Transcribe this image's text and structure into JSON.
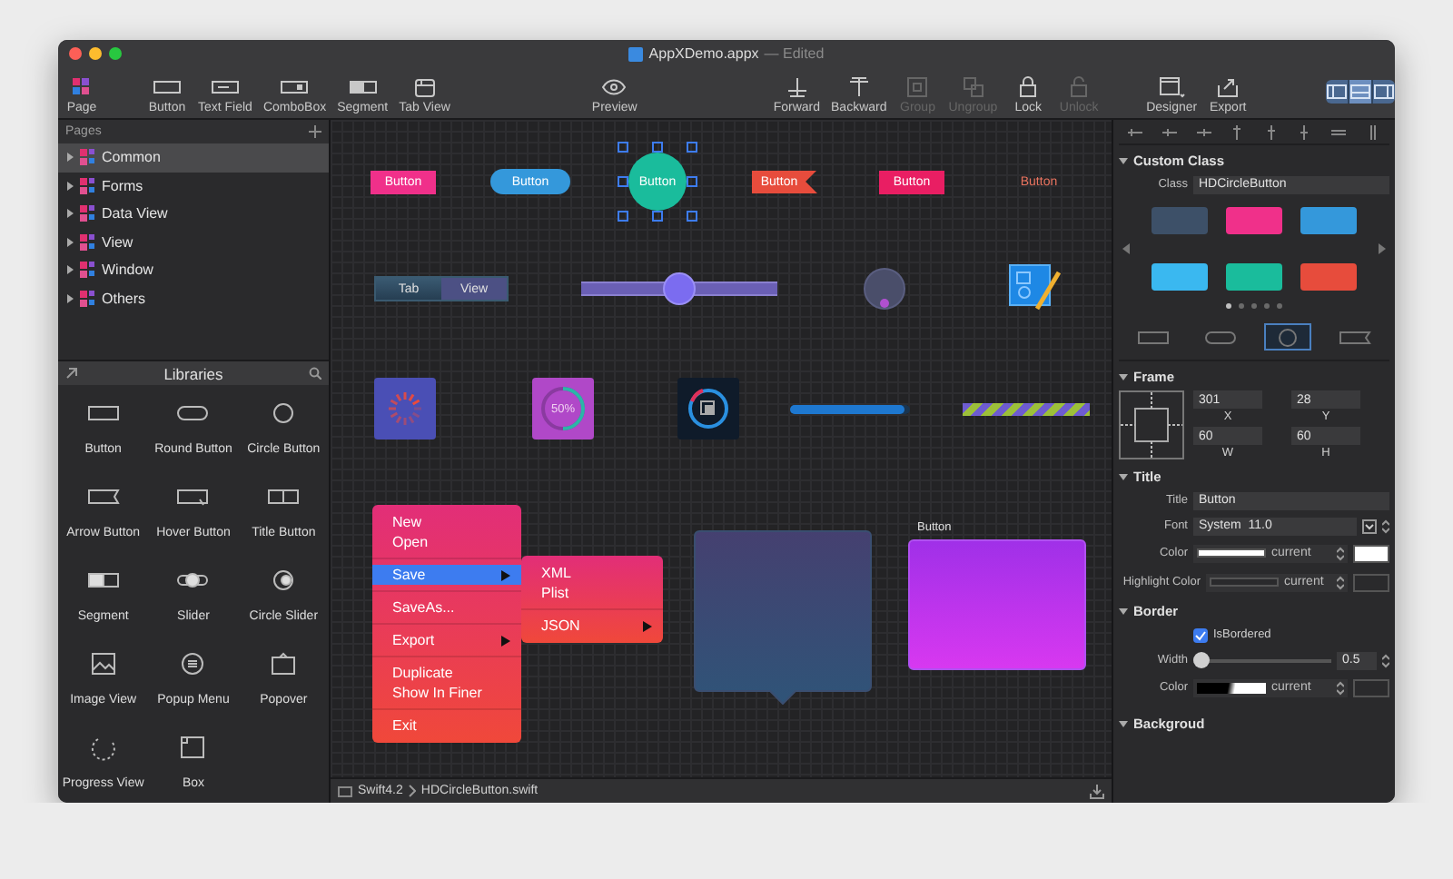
{
  "window": {
    "title": "AppXDemo.appx",
    "status": "— Edited"
  },
  "toolbar": {
    "groups": [
      {
        "items": [
          {
            "kind": "page",
            "label": "Page",
            "disabled": false
          }
        ]
      },
      {
        "items": [
          {
            "kind": "button",
            "label": "Button",
            "disabled": false
          },
          {
            "kind": "textfield",
            "label": "Text Field",
            "disabled": false
          },
          {
            "kind": "combobox",
            "label": "ComboBox",
            "disabled": false
          },
          {
            "kind": "segment",
            "label": "Segment",
            "disabled": false
          },
          {
            "kind": "tabview",
            "label": "Tab View",
            "disabled": false
          }
        ]
      },
      {
        "items": [
          {
            "kind": "preview",
            "label": "Preview",
            "disabled": false
          }
        ]
      },
      {
        "items": [
          {
            "kind": "forward",
            "label": "Forward",
            "disabled": false
          },
          {
            "kind": "backward",
            "label": "Backward",
            "disabled": false
          },
          {
            "kind": "group",
            "label": "Group",
            "disabled": true
          },
          {
            "kind": "ungroup",
            "label": "Ungroup",
            "disabled": true
          },
          {
            "kind": "lock",
            "label": "Lock",
            "disabled": false
          },
          {
            "kind": "unlock",
            "label": "Unlock",
            "disabled": true
          }
        ]
      },
      {
        "items": [
          {
            "kind": "designer",
            "label": "Designer",
            "disabled": false
          },
          {
            "kind": "export",
            "label": "Export",
            "disabled": false
          }
        ]
      }
    ],
    "view_modes": [
      {
        "kind": "left",
        "selected": false
      },
      {
        "kind": "bottom",
        "selected": true
      },
      {
        "kind": "right",
        "selected": false
      }
    ]
  },
  "pages": {
    "title": "Pages",
    "items": [
      {
        "label": "Common",
        "selected": true,
        "expanded": false
      },
      {
        "label": "Forms",
        "selected": false,
        "expanded": false
      },
      {
        "label": "Data View",
        "selected": false,
        "expanded": false
      },
      {
        "label": "View",
        "selected": false,
        "expanded": false
      },
      {
        "label": "Window",
        "selected": false,
        "expanded": false
      },
      {
        "label": "Others",
        "selected": false,
        "expanded": false
      }
    ]
  },
  "libraries": {
    "title": "Libraries",
    "items": [
      {
        "kind": "button",
        "label": "Button"
      },
      {
        "kind": "round",
        "label": "Round Button"
      },
      {
        "kind": "circle",
        "label": "Circle Button"
      },
      {
        "kind": "arrow",
        "label": "Arrow Button"
      },
      {
        "kind": "hover",
        "label": "Hover Button"
      },
      {
        "kind": "title",
        "label": "Title Button"
      },
      {
        "kind": "segment",
        "label": "Segment"
      },
      {
        "kind": "slider",
        "label": "Slider"
      },
      {
        "kind": "circleslider",
        "label": "Circle Slider"
      },
      {
        "kind": "image",
        "label": "Image View"
      },
      {
        "kind": "popup",
        "label": "Popup Menu"
      },
      {
        "kind": "popover",
        "label": "Popover"
      },
      {
        "kind": "progress",
        "label": "Progress View"
      },
      {
        "kind": "box",
        "label": "Box"
      }
    ]
  },
  "canvas": {
    "buttons": [
      {
        "kind": "rect",
        "label": "Button",
        "color": "#f0308a",
        "selected": false
      },
      {
        "kind": "pill",
        "label": "Button",
        "color": "#3498db",
        "selected": false
      },
      {
        "kind": "circle",
        "label": "Button",
        "color": "#1abc9c",
        "selected": true
      },
      {
        "kind": "ribbon",
        "label": "Button",
        "color": "#e74c3c",
        "selected": false
      },
      {
        "kind": "rect",
        "label": "Button",
        "color": "#e91e63",
        "selected": false
      },
      {
        "kind": "text",
        "label": "Button",
        "color": "#e8735f",
        "selected": false
      }
    ],
    "tab_view": {
      "tabs": [
        {
          "label": "Tab",
          "selected": true
        },
        {
          "label": "View",
          "selected": false
        }
      ]
    },
    "slider": {
      "level": 0.5
    },
    "progress_ring": {
      "label": "50%",
      "level": 0.5
    },
    "progress_bar": {
      "level": 0.96
    },
    "striped_bar": {
      "level": 1.0
    },
    "menu": {
      "sections": [
        [
          {
            "label": "New",
            "selected": false,
            "submenu": false
          },
          {
            "label": "Open",
            "selected": false,
            "submenu": false
          }
        ],
        [
          {
            "label": "Save",
            "selected": true,
            "submenu": true
          }
        ],
        [
          {
            "label": "SaveAs...",
            "selected": false,
            "submenu": false
          }
        ],
        [
          {
            "label": "Export",
            "selected": false,
            "submenu": true
          }
        ],
        [
          {
            "label": "Duplicate",
            "selected": false,
            "submenu": false
          },
          {
            "label": "Show In Finer",
            "selected": false,
            "submenu": false
          }
        ],
        [
          {
            "label": "Exit",
            "selected": false,
            "submenu": false
          }
        ]
      ]
    },
    "submenu": {
      "sections": [
        [
          {
            "label": "XML",
            "selected": false,
            "submenu": false
          },
          {
            "label": "Plist",
            "selected": false,
            "submenu": false
          }
        ],
        [
          {
            "label": "JSON",
            "selected": false,
            "submenu": true
          }
        ]
      ]
    },
    "box": {
      "title": "Button"
    }
  },
  "path_bar": {
    "items": [
      "Swift4.2",
      "HDCircleButton.swift"
    ]
  },
  "inspector": {
    "custom_class": {
      "title": "Custom Class",
      "expanded": true,
      "class_label": "Class",
      "class_value": "HDCircleButton",
      "swatches": [
        {
          "color": "#3d5068"
        },
        {
          "color": "#f0308a"
        },
        {
          "color": "#3498db"
        },
        {
          "color": "#3ab8f0"
        },
        {
          "color": "#1abc9c"
        },
        {
          "color": "#e74c3c"
        }
      ],
      "pages": [
        {
          "selected": true
        },
        {
          "selected": false
        },
        {
          "selected": false
        },
        {
          "selected": false
        },
        {
          "selected": false
        }
      ],
      "shapes": [
        {
          "kind": "rect",
          "selected": false
        },
        {
          "kind": "pill",
          "selected": false
        },
        {
          "kind": "circle",
          "selected": true
        },
        {
          "kind": "arrow",
          "selected": false
        }
      ]
    },
    "frame": {
      "title": "Frame",
      "expanded": true,
      "fields": [
        {
          "label": "X",
          "value": "301"
        },
        {
          "label": "Y",
          "value": "28"
        },
        {
          "label": "W",
          "value": "60"
        },
        {
          "label": "H",
          "value": "60"
        }
      ]
    },
    "title_section": {
      "title": "Title",
      "expanded": true,
      "rows": [
        {
          "kind": "text",
          "label": "Title",
          "value": "Button"
        },
        {
          "kind": "font",
          "label": "Font",
          "value": "System  11.0"
        },
        {
          "kind": "color",
          "label": "Color",
          "value": "current",
          "color": "#ffffff"
        },
        {
          "kind": "color",
          "label": "Highlight Color",
          "value": "current",
          "color": "#2a2a2c"
        }
      ]
    },
    "border": {
      "title": "Border",
      "expanded": true,
      "checkbox": {
        "label": "IsBordered",
        "checked": true
      },
      "width": {
        "label": "Width",
        "level": 0.02,
        "value": "0.5"
      },
      "color": {
        "label": "Color",
        "value": "current"
      }
    },
    "background": {
      "title": "Backgroud",
      "expanded": true
    }
  }
}
